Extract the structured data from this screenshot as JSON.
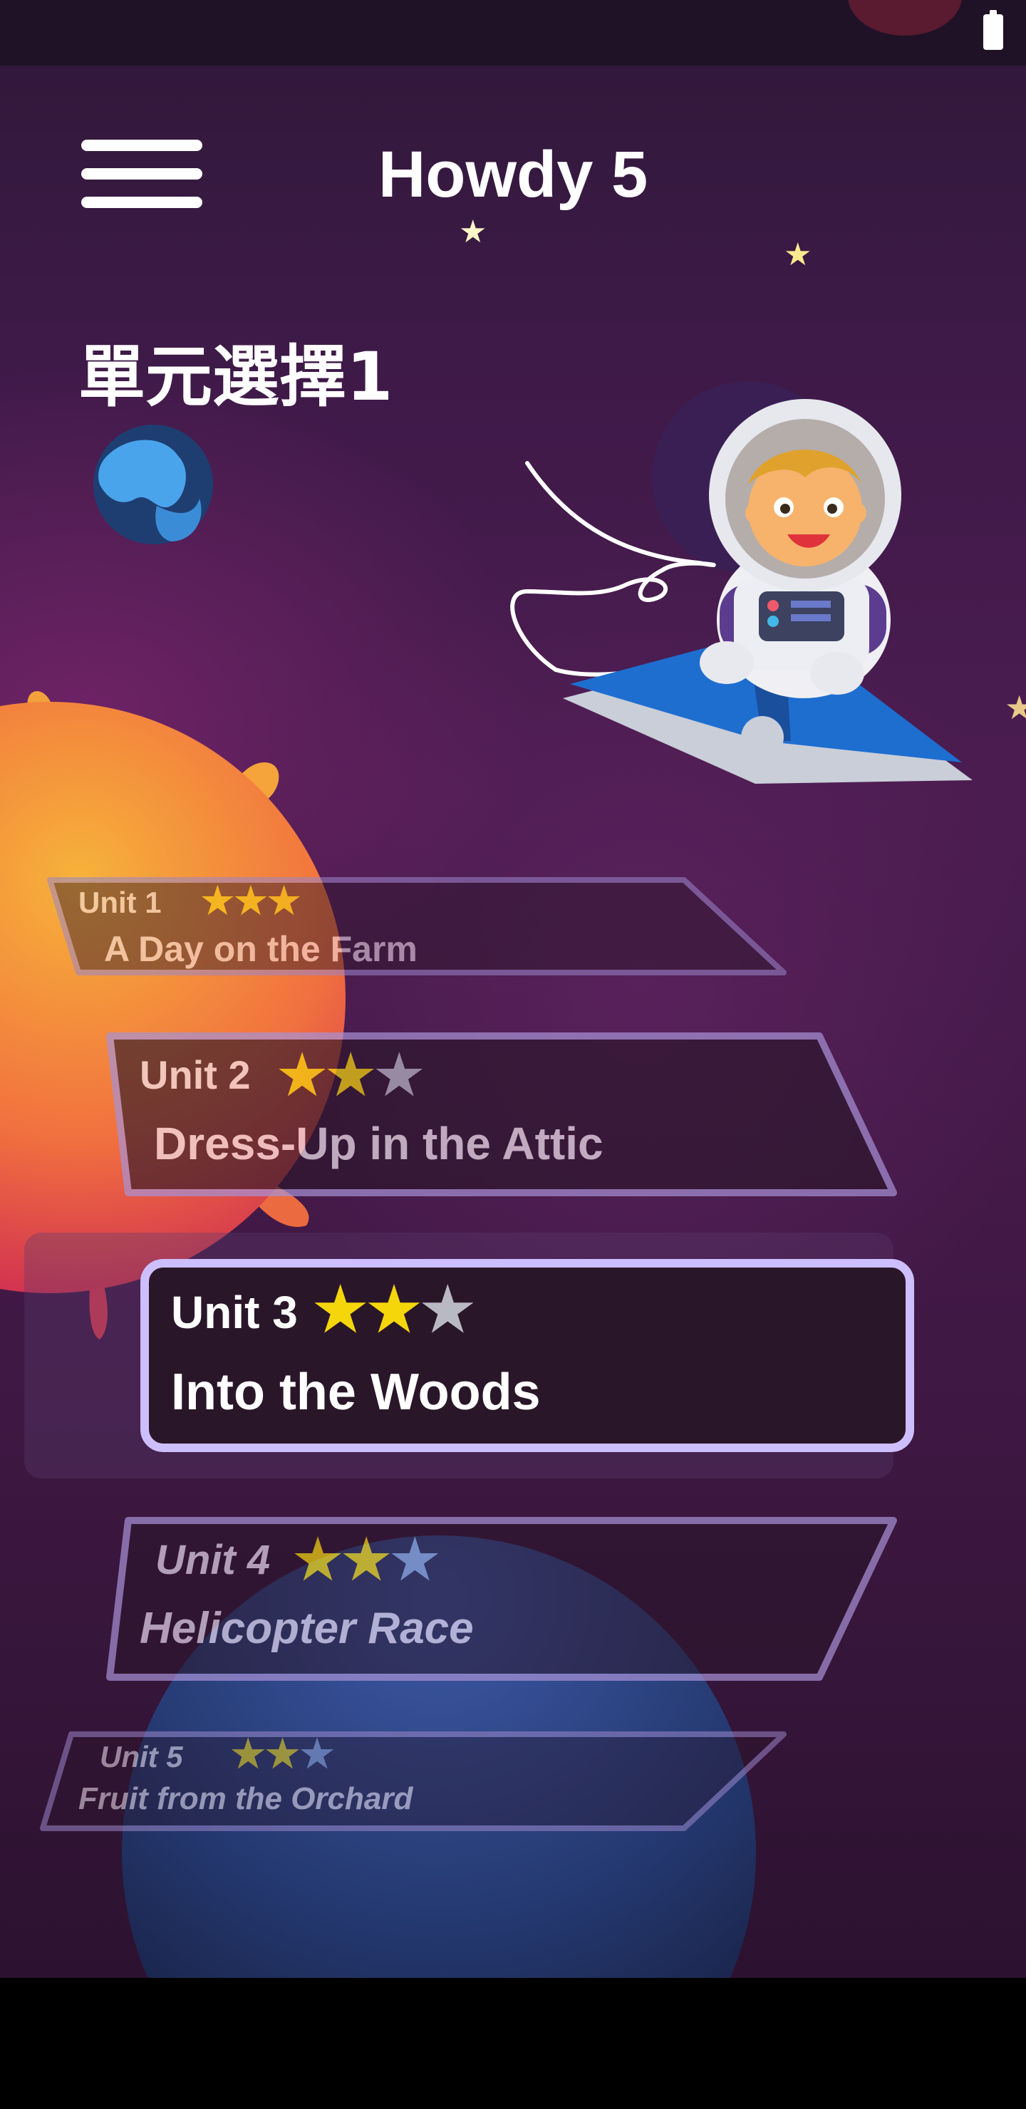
{
  "header": {
    "app_title": "Howdy 5",
    "section_title": "單元選擇1"
  },
  "status_bar": {
    "icons": [
      "battery-icon"
    ]
  },
  "units": [
    {
      "label": "Unit 1",
      "title": "A Day on the Farm",
      "stars_earned": 3,
      "stars_total": 3
    },
    {
      "label": "Unit 2",
      "title": "Dress-Up in the Attic",
      "stars_earned": 2,
      "stars_total": 3
    },
    {
      "label": "Unit 3",
      "title": "Into the Woods",
      "stars_earned": 2,
      "stars_total": 3,
      "selected": true
    },
    {
      "label": "Unit 4",
      "title": "Helicopter Race",
      "stars_earned": 2,
      "stars_total": 3
    },
    {
      "label": "Unit 5",
      "title": "Fruit from the Orchard",
      "stars_earned": 2,
      "stars_total": 3
    }
  ],
  "colors": {
    "star_filled": "#f5d60a",
    "star_empty": "#b9b9c3",
    "card_fill": "#2a1629",
    "card_border_selected": "#cdbfff",
    "background": "#3e1a48"
  }
}
